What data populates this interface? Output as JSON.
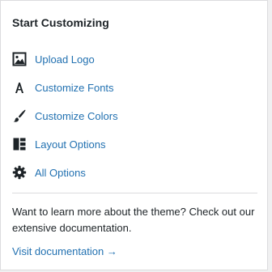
{
  "panel": {
    "title": "Start Customizing",
    "items": [
      {
        "label": "Upload Logo",
        "icon": "image-icon"
      },
      {
        "label": "Customize Fonts",
        "icon": "font-icon"
      },
      {
        "label": "Customize Colors",
        "icon": "brush-icon"
      },
      {
        "label": "Layout Options",
        "icon": "layout-icon"
      },
      {
        "label": "All Options",
        "icon": "gear-icon"
      }
    ],
    "description": "Want to learn more about the theme? Check out our extensive documentation.",
    "doc_link": "Visit documentation →"
  },
  "colors": {
    "link": "#2271b1",
    "text": "#1d2327",
    "icon": "#1d2327"
  }
}
